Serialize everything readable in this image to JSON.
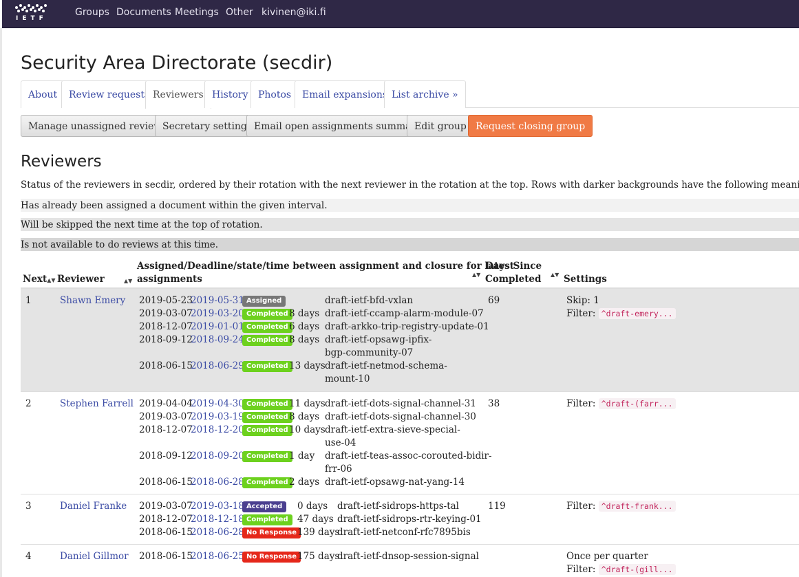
{
  "nav": {
    "logo_text": "IETF",
    "items": [
      "Groups",
      "Documents",
      "Meetings",
      "Other",
      "kivinen@iki.fi"
    ]
  },
  "page_title": "Security Area Directorate (secdir)",
  "tabs": [
    "About",
    "Review requests",
    "Reviewers",
    "History",
    "Photos",
    "Email expansions",
    "List archive »"
  ],
  "buttons": [
    "Manage unassigned reviews",
    "Secretary settings",
    "Email open assignments summary",
    "Edit group",
    "Request closing group"
  ],
  "section_title": "Reviewers",
  "description": "Status of the reviewers in secdir, ordered by their rotation with the next reviewer in the rotation at the top. Rows with darker backgrounds have the following meaning:",
  "legend": [
    "Has already been assigned a document within the given interval.",
    "Will be skipped the next time at the top of rotation.",
    "Is not available to do reviews at this time."
  ],
  "columns": {
    "next": "Next",
    "reviewer": "Reviewer",
    "assigned_line1": "Assigned/Deadline/state/time between assignment and closure for latest",
    "assigned_line2": "assignments",
    "days_line1": "Days Since",
    "days_line2": "Completed",
    "settings": "Settings"
  },
  "reviewers": [
    {
      "next": "1",
      "name": "Shawn Emery",
      "days_since": "69",
      "settings": {
        "skip": "Skip: 1",
        "freq": "",
        "filter_label": "Filter:",
        "filter": "^draft-emery..."
      },
      "assignments": [
        {
          "assigned": "2019-05-23",
          "deadline": "2019-05-31",
          "state": "Assigned",
          "time": "",
          "doc": [
            "draft-ietf-bfd-vxlan"
          ]
        },
        {
          "assigned": "2019-03-07",
          "deadline": "2019-03-20",
          "state": "Completed",
          "time": "8 days",
          "doc": [
            "draft-ietf-ccamp-alarm-module-07"
          ]
        },
        {
          "assigned": "2018-12-07",
          "deadline": "2019-01-01",
          "state": "Completed",
          "time": "6 days",
          "doc": [
            "draft-arkko-trip-registry-update-01"
          ]
        },
        {
          "assigned": "2018-09-12",
          "deadline": "2018-09-24",
          "state": "Completed",
          "time": "8 days",
          "doc": [
            "draft-ietf-opsawg-ipfix-",
            "bgp-community-07"
          ]
        },
        {
          "assigned": "2018-06-15",
          "deadline": "2018-06-29",
          "state": "Completed",
          "time": "13 days",
          "doc": [
            "draft-ietf-netmod-schema-",
            "mount-10"
          ]
        }
      ]
    },
    {
      "next": "2",
      "name": "Stephen Farrell",
      "days_since": "38",
      "settings": {
        "skip": "",
        "freq": "",
        "filter_label": "Filter:",
        "filter": "^draft-(farr..."
      },
      "assignments": [
        {
          "assigned": "2019-04-04",
          "deadline": "2019-04-30",
          "state": "Completed",
          "time": "11 days",
          "doc": [
            "draft-ietf-dots-signal-channel-31"
          ]
        },
        {
          "assigned": "2019-03-07",
          "deadline": "2019-03-19",
          "state": "Completed",
          "time": "8 days",
          "doc": [
            "draft-ietf-dots-signal-channel-30"
          ]
        },
        {
          "assigned": "2018-12-07",
          "deadline": "2018-12-20",
          "state": "Completed",
          "time": "10 days",
          "doc": [
            "draft-ietf-extra-sieve-special-",
            "use-04"
          ]
        },
        {
          "assigned": "2018-09-12",
          "deadline": "2018-09-20",
          "state": "Completed",
          "time": "1 day",
          "doc": [
            "draft-ietf-teas-assoc-corouted-bidir-",
            "frr-06"
          ]
        },
        {
          "assigned": "2018-06-15",
          "deadline": "2018-06-28",
          "state": "Completed",
          "time": "2 days",
          "doc": [
            "draft-ietf-opsawg-nat-yang-14"
          ]
        }
      ]
    },
    {
      "next": "3",
      "name": "Daniel Franke",
      "days_since": "119",
      "settings": {
        "skip": "",
        "freq": "",
        "filter_label": "Filter:",
        "filter": "^draft-frank..."
      },
      "assignments": [
        {
          "assigned": "2019-03-07",
          "deadline": "2019-03-18",
          "state": "Accepted",
          "time": "0 days",
          "doc": [
            "draft-ietf-sidrops-https-tal"
          ]
        },
        {
          "assigned": "2018-12-07",
          "deadline": "2018-12-18",
          "state": "Completed",
          "time": "47 days",
          "doc": [
            "draft-ietf-sidrops-rtr-keying-01"
          ]
        },
        {
          "assigned": "2018-06-15",
          "deadline": "2018-06-28",
          "state": "No Response",
          "time": "139 days",
          "doc": [
            "draft-ietf-netconf-rfc7895bis"
          ]
        }
      ]
    },
    {
      "next": "4",
      "name": "Daniel Gillmor",
      "days_since": "",
      "settings": {
        "skip": "",
        "freq": "Once per quarter",
        "filter_label": "Filter:",
        "filter": "^draft-(gill..."
      },
      "assignments": [
        {
          "assigned": "2018-06-15",
          "deadline": "2018-06-25",
          "state": "No Response",
          "time": "175 days",
          "doc": [
            "draft-ietf-dnsop-session-signal"
          ]
        }
      ]
    }
  ],
  "colors": {
    "navbar": "#2f2846",
    "link": "#3c4ca5",
    "assigned": "#777777",
    "completed": "#6dd11e",
    "accepted": "#4a3f8f",
    "no_response": "#e5271a",
    "warn_button": "#f07a45",
    "row_highlight": "#e4e4e4"
  }
}
